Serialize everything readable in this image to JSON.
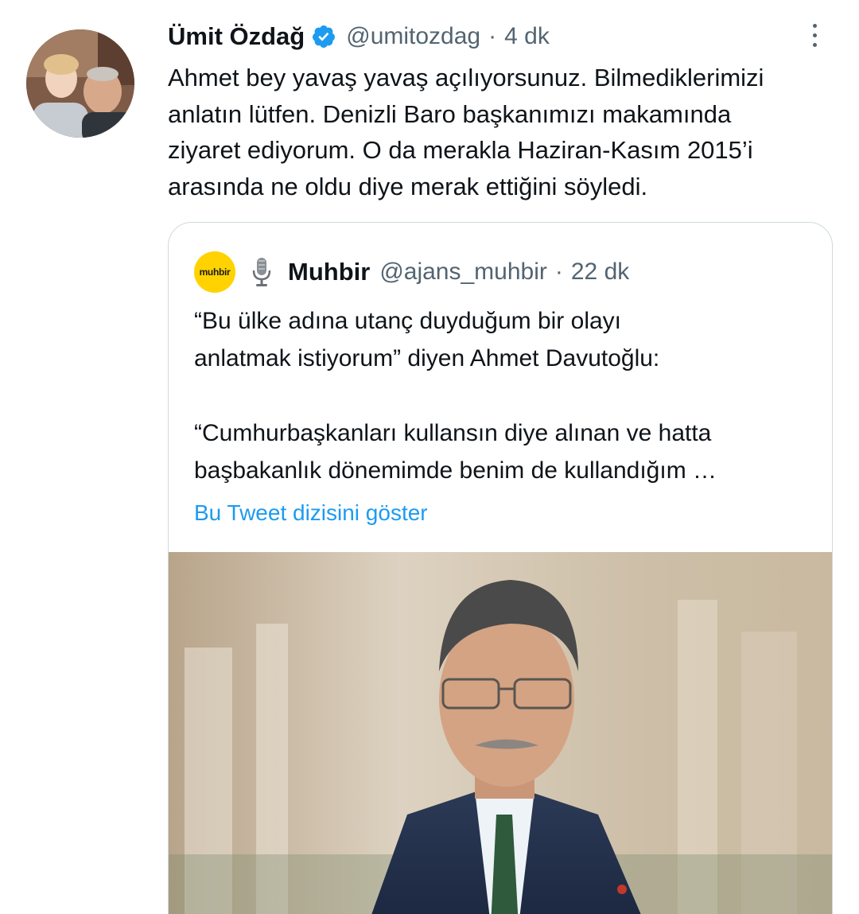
{
  "tweet": {
    "author_name": "Ümit Özdağ",
    "handle": "@umitozdag",
    "separator": "·",
    "time": "4 dk",
    "text_lines": [
      "Ahmet bey yavaş yavaş açılıyorsunuz. Bilmediklerimizi",
      "anlatın lütfen. Denizli Baro başkanımızı makamında",
      "ziyaret ediyorum. O da merakla Haziran-Kasım 2015’i",
      "arasında ne oldu diye merak ettiğini söyledi."
    ]
  },
  "quoted": {
    "avatar_text": "muhbir",
    "author_name": "Muhbir",
    "handle": "@ajans_muhbir",
    "separator": "·",
    "time": "22 dk",
    "text_lines": [
      "“Bu ülke adına utanç duyduğum bir olayı",
      "anlatmak istiyorum” diyen Ahmet Davutoğlu:",
      "“Cumhurbaşkanları kullansın diye alınan ve hatta",
      "başbakanlık dönemimde benim de kullandığım …"
    ],
    "show_thread": "Bu Tweet dizisini göster"
  },
  "colors": {
    "accent": "#1d9bf0",
    "secondary_text": "#536471",
    "border": "#cfd9de",
    "muhbir_brand": "#ffd200"
  },
  "icons": {
    "verified": "verified-badge-icon",
    "more": "more-vertical-icon",
    "mic": "microphone-icon"
  }
}
